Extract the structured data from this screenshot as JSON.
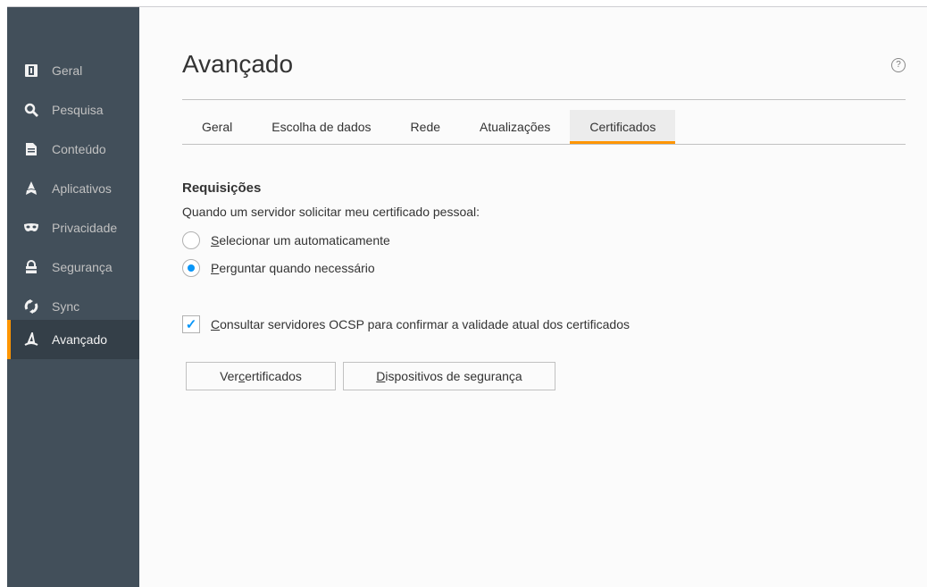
{
  "sidebar": {
    "items": [
      {
        "label": "Geral",
        "icon": "general-icon"
      },
      {
        "label": "Pesquisa",
        "icon": "search-icon"
      },
      {
        "label": "Conteúdo",
        "icon": "document-icon"
      },
      {
        "label": "Aplicativos",
        "icon": "rocket-icon"
      },
      {
        "label": "Privacidade",
        "icon": "mask-icon"
      },
      {
        "label": "Segurança",
        "icon": "lock-icon"
      },
      {
        "label": "Sync",
        "icon": "sync-icon"
      },
      {
        "label": "Avançado",
        "icon": "wizard-hat-icon"
      }
    ],
    "active": "Avançado"
  },
  "header": {
    "title": "Avançado",
    "help_glyph": "?"
  },
  "tabs": [
    {
      "label": "Geral"
    },
    {
      "label": "Escolha de dados"
    },
    {
      "label": "Rede"
    },
    {
      "label": "Atualizações"
    },
    {
      "label": "Certificados"
    }
  ],
  "selected_tab": "Certificados",
  "requests": {
    "heading": "Requisições",
    "description": "Quando um servidor solicitar meu certificado pessoal:",
    "option_auto": {
      "access_key": "S",
      "rest": "elecionar um automaticamente",
      "checked": false
    },
    "option_ask": {
      "access_key": "P",
      "rest": "erguntar quando necessário",
      "checked": true
    }
  },
  "ocsp": {
    "access_key": "C",
    "rest": "onsultar servidores OCSP para confirmar a validade atual dos certificados",
    "checked": true,
    "check_glyph": "✓"
  },
  "buttons": {
    "view_certs": {
      "pre": "Ver ",
      "access_key": "c",
      "post": "ertificados"
    },
    "security_devices": {
      "pre": "",
      "access_key": "D",
      "post": "ispositivos de segurança"
    }
  },
  "colors": {
    "accent": "#ff9500",
    "sidebar_bg": "#424f5a",
    "radio_blue": "#0996f8"
  }
}
